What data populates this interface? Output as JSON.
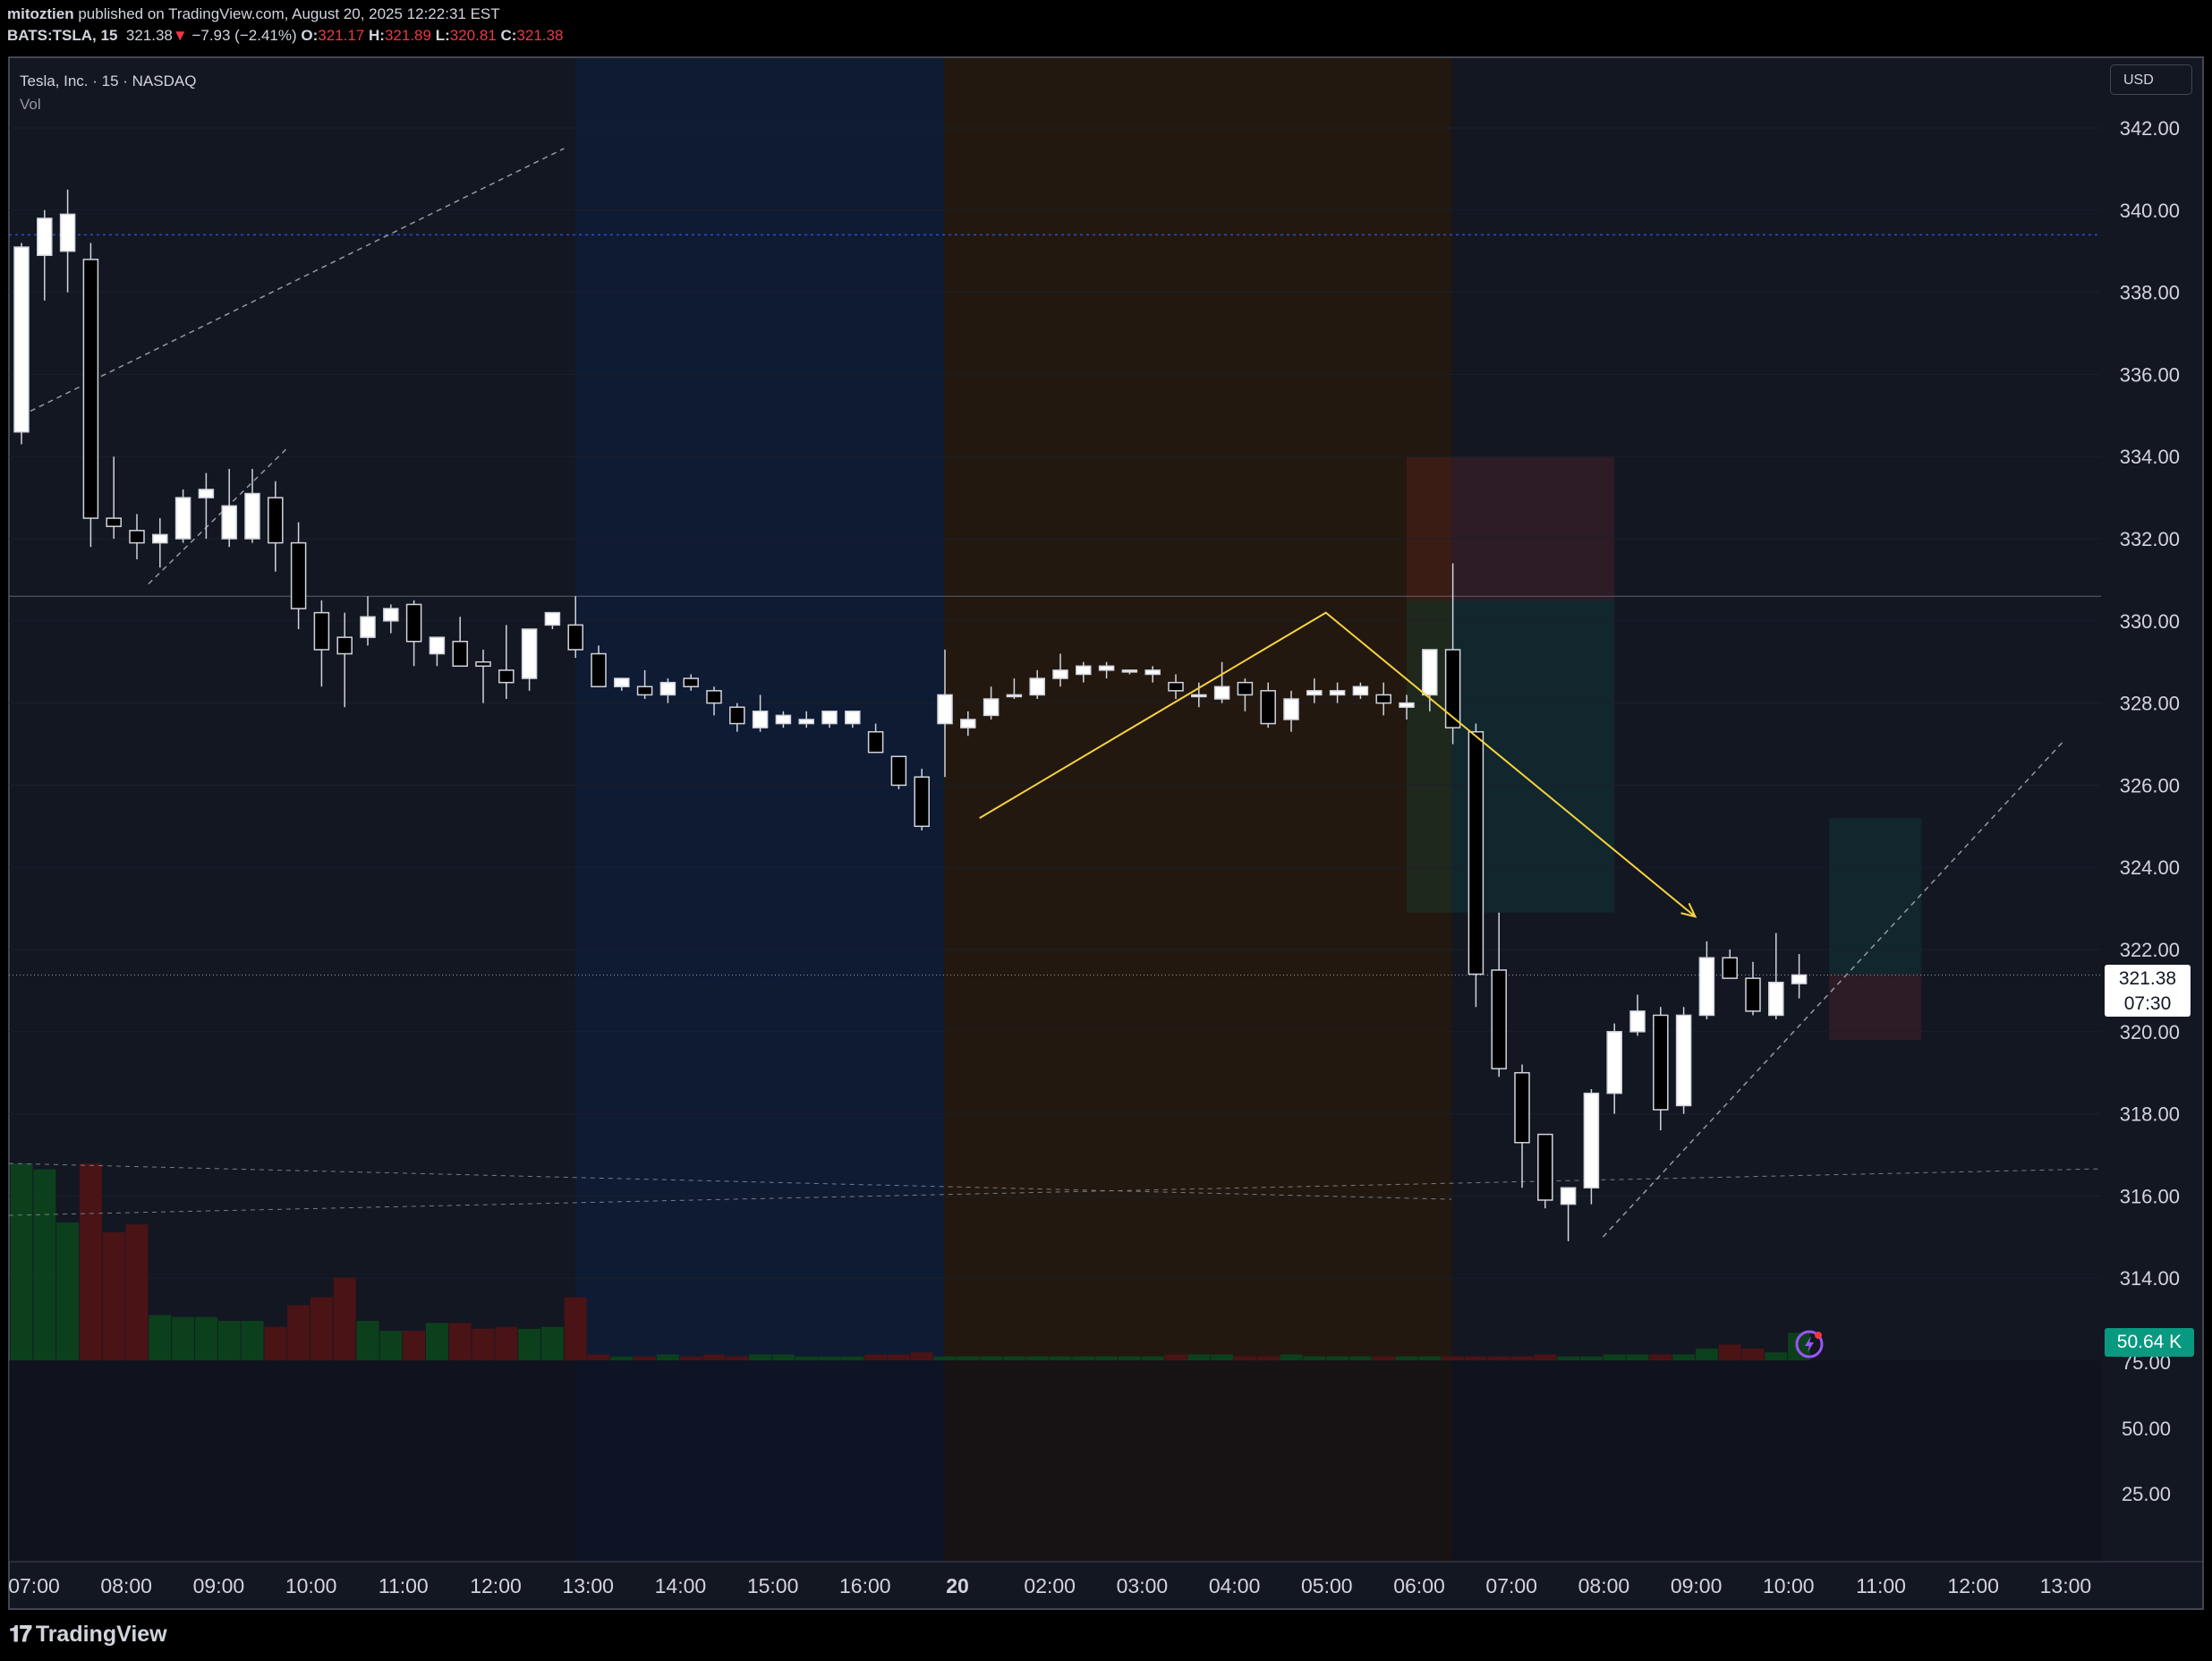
{
  "header": {
    "publisher": "mitoztien",
    "published_text": "published on TradingView.com, August 20, 2025 12:22:31 EST",
    "symbol": "BATS:TSLA, 15",
    "last": "321.38",
    "change": "−7.93 (−2.41%)",
    "o_label": "O:",
    "o_value": "321.17",
    "h_label": "H:",
    "h_value": "321.89",
    "l_label": "L:",
    "l_value": "320.81",
    "c_label": "C:",
    "c_value": "321.38"
  },
  "legend": {
    "title": "Tesla, Inc. · 15 · NASDAQ",
    "vol": "Vol"
  },
  "currency": "USD",
  "price_tag": {
    "price": "321.38",
    "countdown": "07:30"
  },
  "volume_tag": "50.64 K",
  "brand": "TradingView",
  "colors": {
    "bg": "#131722",
    "up_body": "#ffffff",
    "down_body": "#000000",
    "vol_up": "#0c3f1c",
    "vol_down": "#4a1316",
    "session_blue": "#0f1a33",
    "session_orange": "#22180f",
    "projection_line": "#f7d23e",
    "text": "#d1d4dc"
  },
  "chart_data": {
    "type": "candlestick",
    "title": "Tesla, Inc. · 15 · NASDAQ",
    "interval": "15",
    "price_axis": {
      "ticks": [
        "342.00",
        "340.00",
        "338.00",
        "336.00",
        "334.00",
        "332.00",
        "330.00",
        "328.00",
        "326.00",
        "324.00",
        "322.00",
        "320.00",
        "318.00",
        "316.00",
        "314.00"
      ],
      "range": [
        312.2,
        343.5
      ]
    },
    "volume_axis": {
      "ticks": [
        "75.00",
        "50.00",
        "25.00"
      ]
    },
    "time_axis": [
      "07:00",
      "08:00",
      "09:00",
      "10:00",
      "11:00",
      "12:00",
      "13:00",
      "14:00",
      "15:00",
      "16:00",
      "20",
      "02:00",
      "03:00",
      "04:00",
      "05:00",
      "06:00",
      "07:00",
      "08:00",
      "09:00",
      "10:00",
      "11:00",
      "12:00",
      "13:00"
    ],
    "last_price": 321.38,
    "horizontal_levels": [
      339.4,
      330.6
    ],
    "candles": [
      {
        "o": 334.6,
        "h": 339.2,
        "l": 334.3,
        "c": 339.1
      },
      {
        "o": 338.9,
        "h": 340.0,
        "l": 337.8,
        "c": 339.8
      },
      {
        "o": 339.0,
        "h": 340.5,
        "l": 338.0,
        "c": 339.9
      },
      {
        "o": 338.8,
        "h": 339.2,
        "l": 331.8,
        "c": 332.5
      },
      {
        "o": 332.5,
        "h": 334.0,
        "l": 332.0,
        "c": 332.3
      },
      {
        "o": 332.2,
        "h": 332.6,
        "l": 331.5,
        "c": 331.9
      },
      {
        "o": 331.9,
        "h": 332.5,
        "l": 331.3,
        "c": 332.1
      },
      {
        "o": 332.0,
        "h": 333.2,
        "l": 331.9,
        "c": 333.0
      },
      {
        "o": 333.0,
        "h": 333.6,
        "l": 332.0,
        "c": 333.2
      },
      {
        "o": 332.0,
        "h": 333.7,
        "l": 331.8,
        "c": 332.8
      },
      {
        "o": 332.0,
        "h": 333.7,
        "l": 331.9,
        "c": 333.1
      },
      {
        "o": 333.0,
        "h": 333.4,
        "l": 331.2,
        "c": 331.9
      },
      {
        "o": 331.9,
        "h": 332.4,
        "l": 329.8,
        "c": 330.3
      },
      {
        "o": 330.2,
        "h": 330.5,
        "l": 328.4,
        "c": 329.3
      },
      {
        "o": 329.6,
        "h": 330.2,
        "l": 327.9,
        "c": 329.2
      },
      {
        "o": 329.6,
        "h": 330.6,
        "l": 329.4,
        "c": 330.1
      },
      {
        "o": 330.0,
        "h": 330.4,
        "l": 329.7,
        "c": 330.3
      },
      {
        "o": 330.4,
        "h": 330.5,
        "l": 328.9,
        "c": 329.5
      },
      {
        "o": 329.2,
        "h": 329.6,
        "l": 328.9,
        "c": 329.6
      },
      {
        "o": 329.5,
        "h": 330.1,
        "l": 328.9,
        "c": 328.9
      },
      {
        "o": 329.0,
        "h": 329.3,
        "l": 328.0,
        "c": 328.9
      },
      {
        "o": 328.8,
        "h": 329.9,
        "l": 328.1,
        "c": 328.5
      },
      {
        "o": 328.6,
        "h": 329.5,
        "l": 328.3,
        "c": 329.8
      },
      {
        "o": 329.9,
        "h": 330.2,
        "l": 329.8,
        "c": 330.2
      },
      {
        "o": 329.9,
        "h": 330.6,
        "l": 329.1,
        "c": 329.3
      },
      {
        "o": 329.2,
        "h": 329.4,
        "l": 328.4,
        "c": 328.4
      },
      {
        "o": 328.4,
        "h": 328.6,
        "l": 328.3,
        "c": 328.6
      },
      {
        "o": 328.4,
        "h": 328.8,
        "l": 328.1,
        "c": 328.2
      },
      {
        "o": 328.2,
        "h": 328.6,
        "l": 328.0,
        "c": 328.5
      },
      {
        "o": 328.6,
        "h": 328.7,
        "l": 328.3,
        "c": 328.4
      },
      {
        "o": 328.3,
        "h": 328.4,
        "l": 327.7,
        "c": 328.0
      },
      {
        "o": 327.9,
        "h": 328.0,
        "l": 327.3,
        "c": 327.5
      },
      {
        "o": 327.4,
        "h": 328.2,
        "l": 327.3,
        "c": 327.8
      },
      {
        "o": 327.5,
        "h": 327.8,
        "l": 327.4,
        "c": 327.7
      },
      {
        "o": 327.5,
        "h": 327.8,
        "l": 327.4,
        "c": 327.6
      },
      {
        "o": 327.5,
        "h": 327.8,
        "l": 327.4,
        "c": 327.8
      },
      {
        "o": 327.5,
        "h": 327.8,
        "l": 327.4,
        "c": 327.8
      },
      {
        "o": 327.3,
        "h": 327.5,
        "l": 326.8,
        "c": 326.8
      },
      {
        "o": 326.7,
        "h": 326.7,
        "l": 325.9,
        "c": 326.0
      },
      {
        "o": 326.2,
        "h": 326.4,
        "l": 324.9,
        "c": 325.0
      },
      {
        "o": 327.5,
        "h": 329.3,
        "l": 326.2,
        "c": 328.2
      },
      {
        "o": 327.4,
        "h": 327.8,
        "l": 327.2,
        "c": 327.6
      },
      {
        "o": 327.7,
        "h": 328.4,
        "l": 327.6,
        "c": 328.1
      },
      {
        "o": 328.2,
        "h": 328.6,
        "l": 328.1,
        "c": 328.2
      },
      {
        "o": 328.2,
        "h": 328.8,
        "l": 328.1,
        "c": 328.6
      },
      {
        "o": 328.6,
        "h": 329.2,
        "l": 328.4,
        "c": 328.8
      },
      {
        "o": 328.7,
        "h": 329.0,
        "l": 328.5,
        "c": 328.9
      },
      {
        "o": 328.8,
        "h": 329.0,
        "l": 328.6,
        "c": 328.9
      },
      {
        "o": 328.8,
        "h": 328.8,
        "l": 328.7,
        "c": 328.8
      },
      {
        "o": 328.7,
        "h": 328.9,
        "l": 328.5,
        "c": 328.8
      },
      {
        "o": 328.5,
        "h": 328.7,
        "l": 328.1,
        "c": 328.3
      },
      {
        "o": 328.2,
        "h": 328.5,
        "l": 327.9,
        "c": 328.2
      },
      {
        "o": 328.1,
        "h": 329.0,
        "l": 328.0,
        "c": 328.4
      },
      {
        "o": 328.5,
        "h": 328.6,
        "l": 327.8,
        "c": 328.2
      },
      {
        "o": 328.3,
        "h": 328.5,
        "l": 327.4,
        "c": 327.5
      },
      {
        "o": 327.6,
        "h": 328.3,
        "l": 327.3,
        "c": 328.1
      },
      {
        "o": 328.2,
        "h": 328.6,
        "l": 328.0,
        "c": 328.3
      },
      {
        "o": 328.2,
        "h": 328.5,
        "l": 328.0,
        "c": 328.3
      },
      {
        "o": 328.2,
        "h": 328.5,
        "l": 328.1,
        "c": 328.4
      },
      {
        "o": 328.2,
        "h": 328.5,
        "l": 327.7,
        "c": 328.0
      },
      {
        "o": 327.9,
        "h": 328.2,
        "l": 327.6,
        "c": 328.0
      },
      {
        "o": 328.2,
        "h": 329.3,
        "l": 327.8,
        "c": 329.3
      },
      {
        "o": 329.3,
        "h": 331.4,
        "l": 327.0,
        "c": 327.4
      },
      {
        "o": 327.3,
        "h": 327.5,
        "l": 320.6,
        "c": 321.4
      },
      {
        "o": 321.5,
        "h": 322.9,
        "l": 318.9,
        "c": 319.1
      },
      {
        "o": 319.0,
        "h": 319.2,
        "l": 316.2,
        "c": 317.3
      },
      {
        "o": 317.5,
        "h": 317.5,
        "l": 315.7,
        "c": 315.9
      },
      {
        "o": 315.8,
        "h": 316.1,
        "l": 314.9,
        "c": 316.2
      },
      {
        "o": 316.2,
        "h": 318.6,
        "l": 315.8,
        "c": 318.5
      },
      {
        "o": 318.5,
        "h": 320.2,
        "l": 318.0,
        "c": 320.0
      },
      {
        "o": 320.0,
        "h": 320.9,
        "l": 319.9,
        "c": 320.5
      },
      {
        "o": 320.4,
        "h": 320.6,
        "l": 317.6,
        "c": 318.1
      },
      {
        "o": 318.2,
        "h": 320.6,
        "l": 318.0,
        "c": 320.4
      },
      {
        "o": 320.4,
        "h": 322.2,
        "l": 320.3,
        "c": 321.8
      },
      {
        "o": 321.8,
        "h": 322.0,
        "l": 321.3,
        "c": 321.3
      },
      {
        "o": 321.3,
        "h": 321.7,
        "l": 320.4,
        "c": 320.5
      },
      {
        "o": 320.4,
        "h": 322.4,
        "l": 320.3,
        "c": 321.2
      },
      {
        "o": 321.17,
        "h": 321.89,
        "l": 320.81,
        "c": 321.38
      }
    ],
    "volume_mock": [
      100,
      97,
      70,
      100,
      65,
      69,
      23,
      22,
      22,
      20,
      20,
      17,
      28,
      32,
      42,
      20,
      15,
      15,
      19,
      19,
      16,
      17,
      16,
      17,
      32,
      3,
      2,
      2,
      3,
      2,
      3,
      2,
      3,
      3,
      2,
      2,
      2,
      3,
      3,
      4,
      2,
      2,
      2,
      2,
      2,
      2,
      2,
      2,
      2,
      2,
      3,
      3,
      3,
      2,
      2,
      3,
      2,
      2,
      2,
      2,
      2,
      2,
      2,
      2,
      2,
      2,
      3,
      2,
      2,
      3,
      3,
      3,
      3,
      6,
      8,
      6,
      4,
      14
    ],
    "trend_lines": [
      {
        "from": [
          0,
          335.0
        ],
        "to": [
          23.5,
          341.5
        ],
        "style": "dashed"
      },
      {
        "from": [
          5.5,
          330.9
        ],
        "to": [
          11.5,
          334.2
        ],
        "style": "dashed"
      },
      {
        "from": [
          68.5,
          315.0
        ],
        "to": [
          88.5,
          327.1
        ],
        "style": "dashed"
      }
    ],
    "projection": {
      "points": [
        [
          41.5,
          325.2
        ],
        [
          56.5,
          330.2
        ],
        [
          72.5,
          322.8
        ]
      ]
    },
    "position_boxes": [
      {
        "x0": 60.0,
        "x1": 69.0,
        "top": 334.0,
        "bottom": 330.5,
        "kind": "risk"
      },
      {
        "x0": 60.0,
        "x1": 69.0,
        "top": 330.5,
        "bottom": 322.9,
        "kind": "reward"
      },
      {
        "x0": 78.3,
        "x1": 82.3,
        "top": 325.2,
        "bottom": 321.4,
        "kind": "reward"
      },
      {
        "x0": 78.3,
        "x1": 82.3,
        "top": 321.4,
        "bottom": 319.8,
        "kind": "risk"
      }
    ]
  }
}
